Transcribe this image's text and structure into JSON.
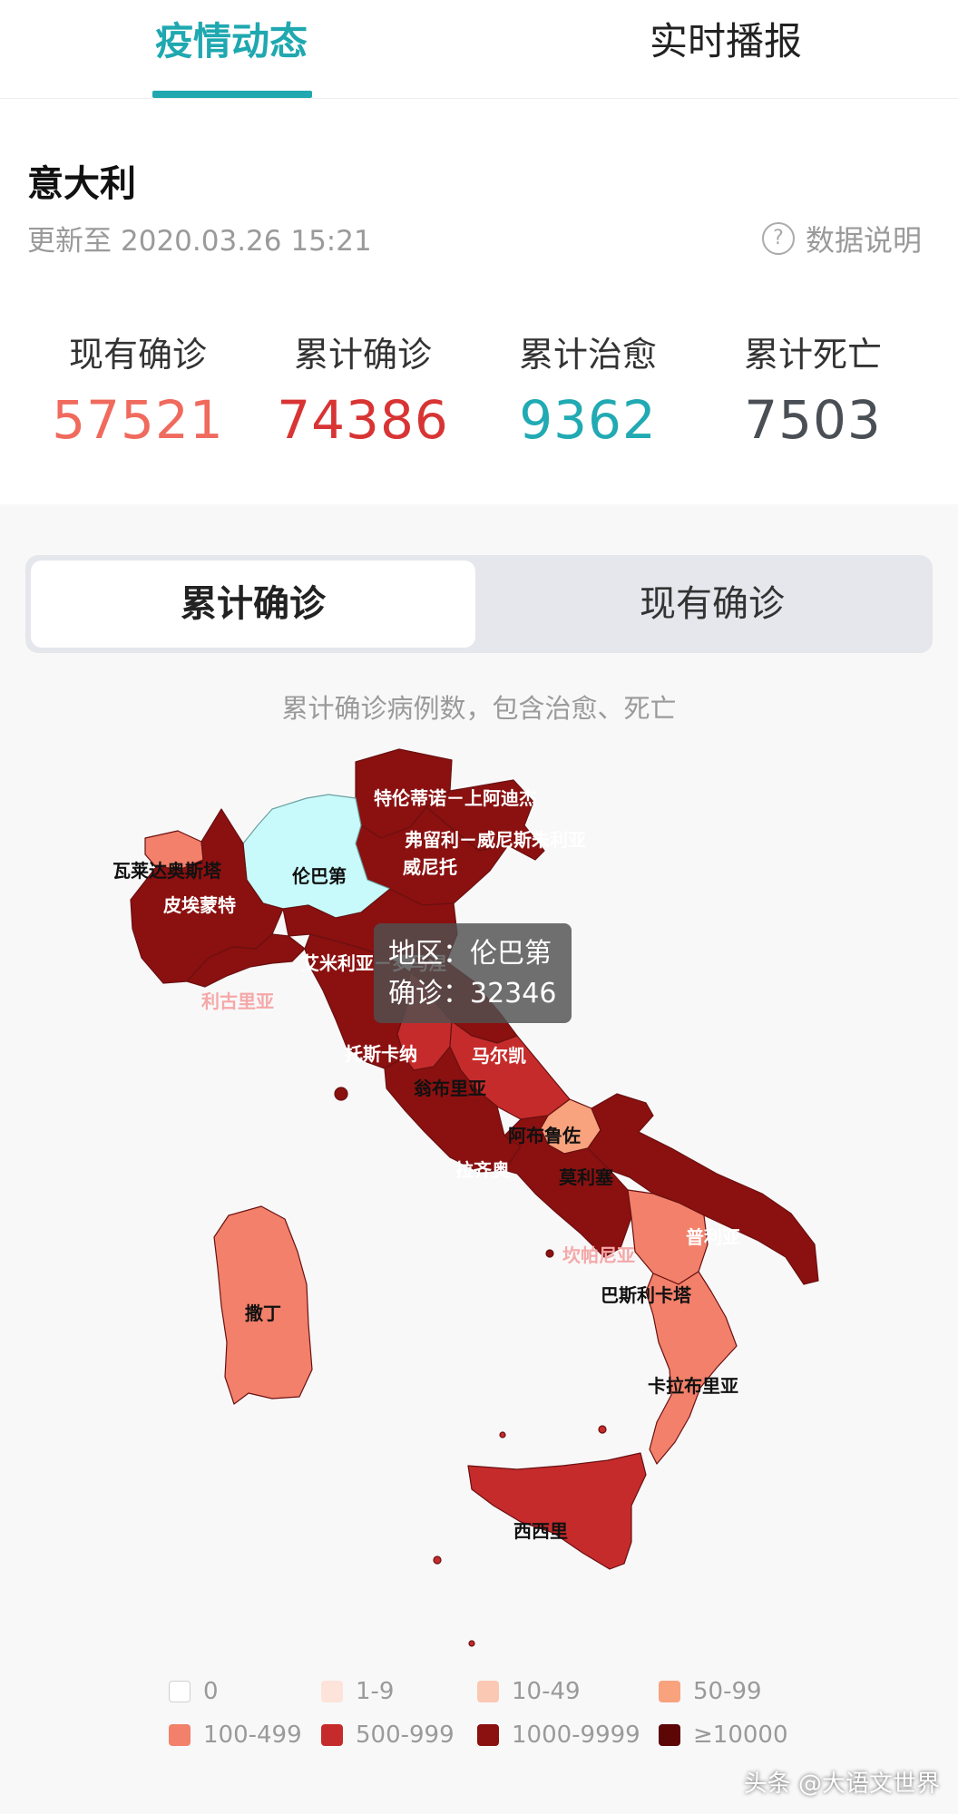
{
  "tabs": [
    {
      "label": "疫情动态",
      "active": true
    },
    {
      "label": "实时播报",
      "active": false
    }
  ],
  "colors": {
    "accent": "#1fa8b0",
    "current": "#f06a5e",
    "total": "#d83434",
    "recovered": "#21aab3",
    "dead": "#4a4f55"
  },
  "header": {
    "country": "意大利",
    "update_prefix": "更新至",
    "update_time": "2020.03.26 15:21",
    "info_label": "数据说明",
    "info_icon": "question-circle-icon"
  },
  "stats": [
    {
      "label": "现有确诊",
      "value": "57521"
    },
    {
      "label": "累计确诊",
      "value": "74386"
    },
    {
      "label": "累计治愈",
      "value": "9362"
    },
    {
      "label": "累计死亡",
      "value": "7503"
    }
  ],
  "toggle": {
    "options": [
      {
        "label": "累计确诊",
        "active": true
      },
      {
        "label": "现有确诊",
        "active": false
      }
    ]
  },
  "map_description": "累计确诊病例数，包含治愈、死亡",
  "map": {
    "regions": [
      {
        "name": "特伦蒂诺－上阿迪杰",
        "color": "#8b1010"
      },
      {
        "name": "弗留利－威尼斯朱利亚",
        "color": "#8b1010"
      },
      {
        "name": "威尼托",
        "color": "#8b1010"
      },
      {
        "name": "伦巴第",
        "color": "#c8fafb",
        "selected": true
      },
      {
        "name": "瓦莱达奥斯塔",
        "color": "#f2806a"
      },
      {
        "name": "皮埃蒙特",
        "color": "#8b1010"
      },
      {
        "name": "艾米利亚－罗马涅",
        "color": "#8b1010"
      },
      {
        "name": "利古里亚",
        "color": "#8b1010"
      },
      {
        "name": "托斯卡纳",
        "color": "#8b1010"
      },
      {
        "name": "马尔凯",
        "color": "#8b1010"
      },
      {
        "name": "翁布里亚",
        "color": "#c62b2b"
      },
      {
        "name": "阿布鲁佐",
        "color": "#c62b2b"
      },
      {
        "name": "拉齐奥",
        "color": "#8b1010"
      },
      {
        "name": "莫利塞",
        "color": "#f8a27e"
      },
      {
        "name": "坎帕尼亚",
        "color": "#8b1010"
      },
      {
        "name": "普利亚",
        "color": "#8b1010"
      },
      {
        "name": "巴斯利卡塔",
        "color": "#f2806a"
      },
      {
        "name": "卡拉布里亚",
        "color": "#f2806a"
      },
      {
        "name": "撒丁",
        "color": "#f2806a"
      },
      {
        "name": "西西里",
        "color": "#c62b2b"
      }
    ],
    "tooltip": {
      "region_label": "地区：伦巴第",
      "confirmed_label": "确诊：32346",
      "region": "伦巴第",
      "confirmed": 32346
    }
  },
  "legend": [
    {
      "label": "0",
      "color": "#ffffff"
    },
    {
      "label": "1-9",
      "color": "#fde3da"
    },
    {
      "label": "10-49",
      "color": "#fbc8b4"
    },
    {
      "label": "50-99",
      "color": "#f8a27e"
    },
    {
      "label": "100-499",
      "color": "#f2806a"
    },
    {
      "label": "500-999",
      "color": "#c62b2b"
    },
    {
      "label": "1000-9999",
      "color": "#8b1010"
    },
    {
      "label": "≥10000",
      "color": "#5c0606"
    }
  ],
  "watermark": "头条 @大语文世界"
}
